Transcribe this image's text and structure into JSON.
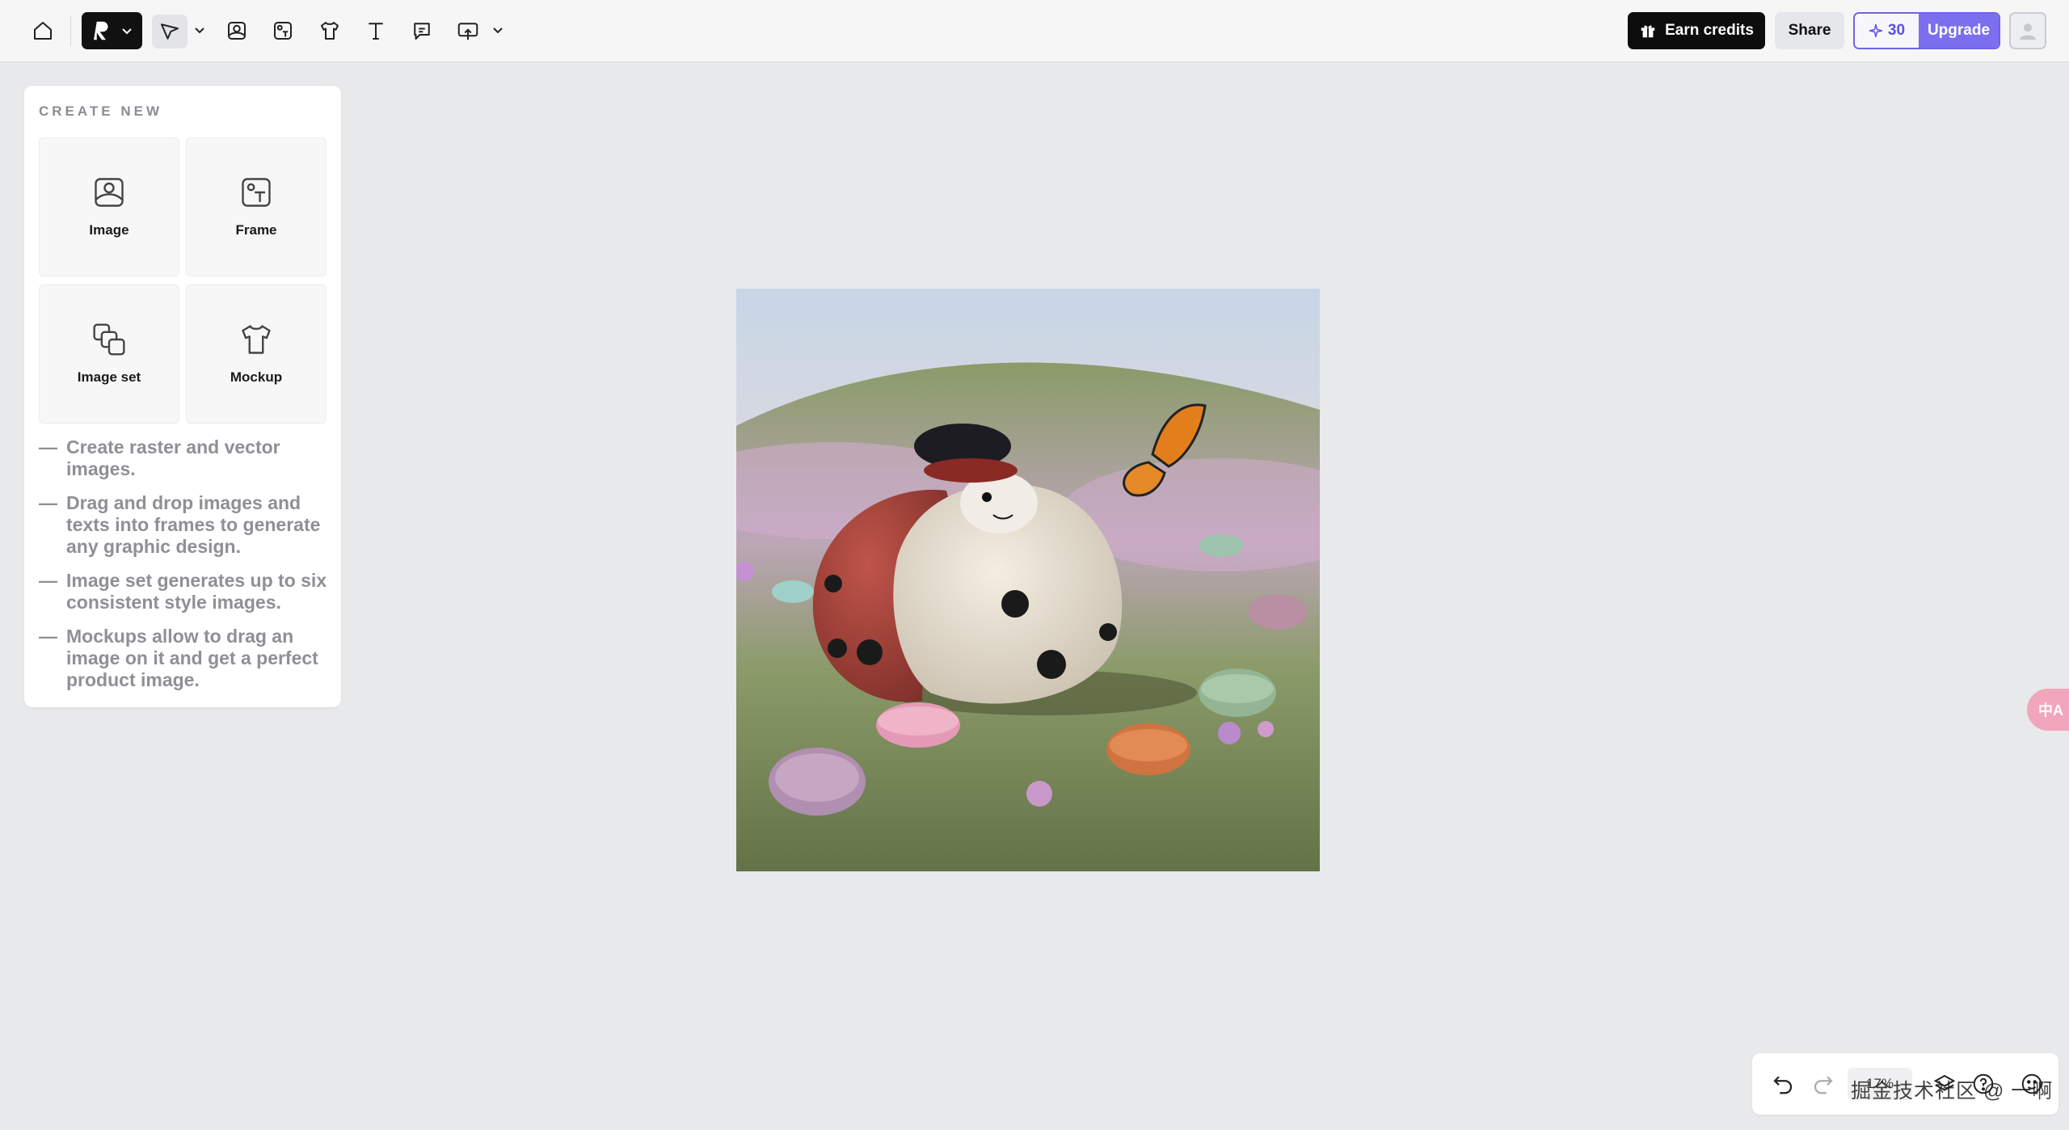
{
  "toolbar": {
    "icons": [
      "home-icon",
      "brand-logo-icon",
      "select-tool-icon",
      "image-tool-icon",
      "frame-tool-icon",
      "mockup-tool-icon",
      "text-tool-icon",
      "comment-tool-icon",
      "upload-tool-icon"
    ],
    "earn_credits_label": "Earn credits",
    "share_label": "Share",
    "credits_count": "30",
    "upgrade_label": "Upgrade"
  },
  "panel": {
    "title": "CREATE NEW",
    "tiles": [
      {
        "label": "Image",
        "icon": "image-icon"
      },
      {
        "label": "Frame",
        "icon": "frame-icon"
      },
      {
        "label": "Image set",
        "icon": "image-set-icon"
      },
      {
        "label": "Mockup",
        "icon": "tshirt-icon"
      }
    ],
    "tips": [
      "Create raster and vector images.",
      "Drag and drop images and texts into frames to generate any graphic design.",
      "Image set generates up to six consistent style images.",
      "Mockups allow to drag an image on it and get a perfect product image."
    ]
  },
  "canvas": {
    "image_subject": "plush ladybug with hat in flowery meadow with macarons and butterfly"
  },
  "bottom": {
    "zoom": "17%",
    "watermark": "掘金技术社区 @ 一啊"
  },
  "side_bubble": "中A",
  "colors": {
    "accent": "#7b6ff0",
    "dark": "#0d0d0d",
    "background": "#e8e9eb"
  }
}
